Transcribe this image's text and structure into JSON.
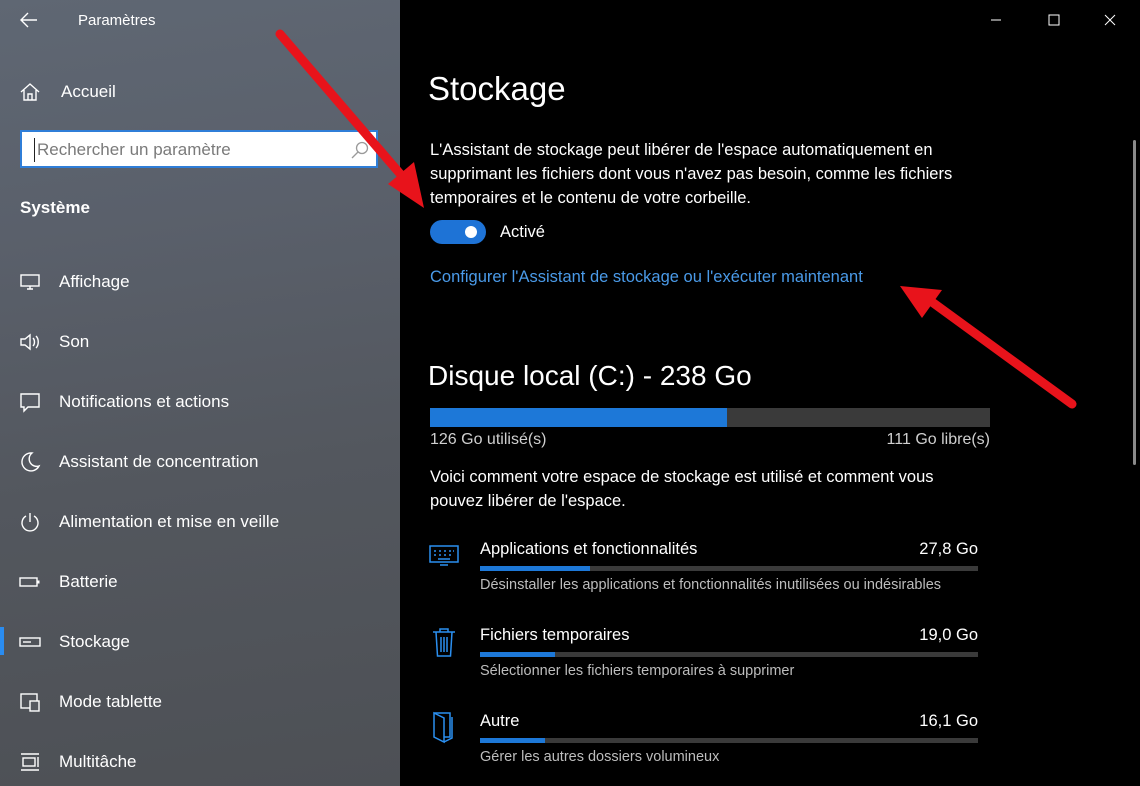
{
  "window": {
    "title": "Paramètres"
  },
  "sidebar": {
    "home_label": "Accueil",
    "search_placeholder": "Rechercher un paramètre",
    "section": "Système",
    "items": [
      {
        "label": "Affichage",
        "icon": "monitor-icon"
      },
      {
        "label": "Son",
        "icon": "speaker-icon"
      },
      {
        "label": "Notifications et actions",
        "icon": "notification-icon"
      },
      {
        "label": "Assistant de concentration",
        "icon": "moon-icon"
      },
      {
        "label": "Alimentation et mise en veille",
        "icon": "power-icon"
      },
      {
        "label": "Batterie",
        "icon": "battery-icon"
      },
      {
        "label": "Stockage",
        "icon": "storage-icon",
        "selected": true
      },
      {
        "label": "Mode tablette",
        "icon": "tablet-icon"
      },
      {
        "label": "Multitâche",
        "icon": "multitask-icon"
      }
    ]
  },
  "main": {
    "title": "Stockage",
    "description": "L'Assistant de stockage peut libérer de l'espace automatiquement en supprimant les fichiers dont vous n'avez pas besoin, comme les fichiers temporaires et le contenu de votre corbeille.",
    "toggle": {
      "state": "on",
      "label": "Activé"
    },
    "config_link": "Configurer l'Assistant de stockage ou l'exécuter maintenant",
    "disk": {
      "title": "Disque local (C:) - 238 Go",
      "used": "126 Go utilisé(s)",
      "free": "111 Go libre(s)",
      "used_fraction": 0.53
    },
    "disk_description": "Voici comment votre espace de stockage est utilisé et comment vous pouvez libérer de l'espace.",
    "categories": [
      {
        "name": "Applications et fonctionnalités",
        "size": "27,8 Go",
        "description": "Désinstaller les applications et fonctionnalités inutilisées ou indésirables",
        "icon": "keyboard-icon",
        "fraction": 0.22
      },
      {
        "name": "Fichiers temporaires",
        "size": "19,0 Go",
        "description": "Sélectionner les fichiers temporaires à supprimer",
        "icon": "trash-icon",
        "fraction": 0.15
      },
      {
        "name": "Autre",
        "size": "16,1 Go",
        "description": "Gérer les autres dossiers volumineux",
        "icon": "folder-icon",
        "fraction": 0.13
      }
    ]
  },
  "colors": {
    "accent": "#1d78d8",
    "link": "#4a9ae8",
    "annotation": "#e8131b"
  }
}
